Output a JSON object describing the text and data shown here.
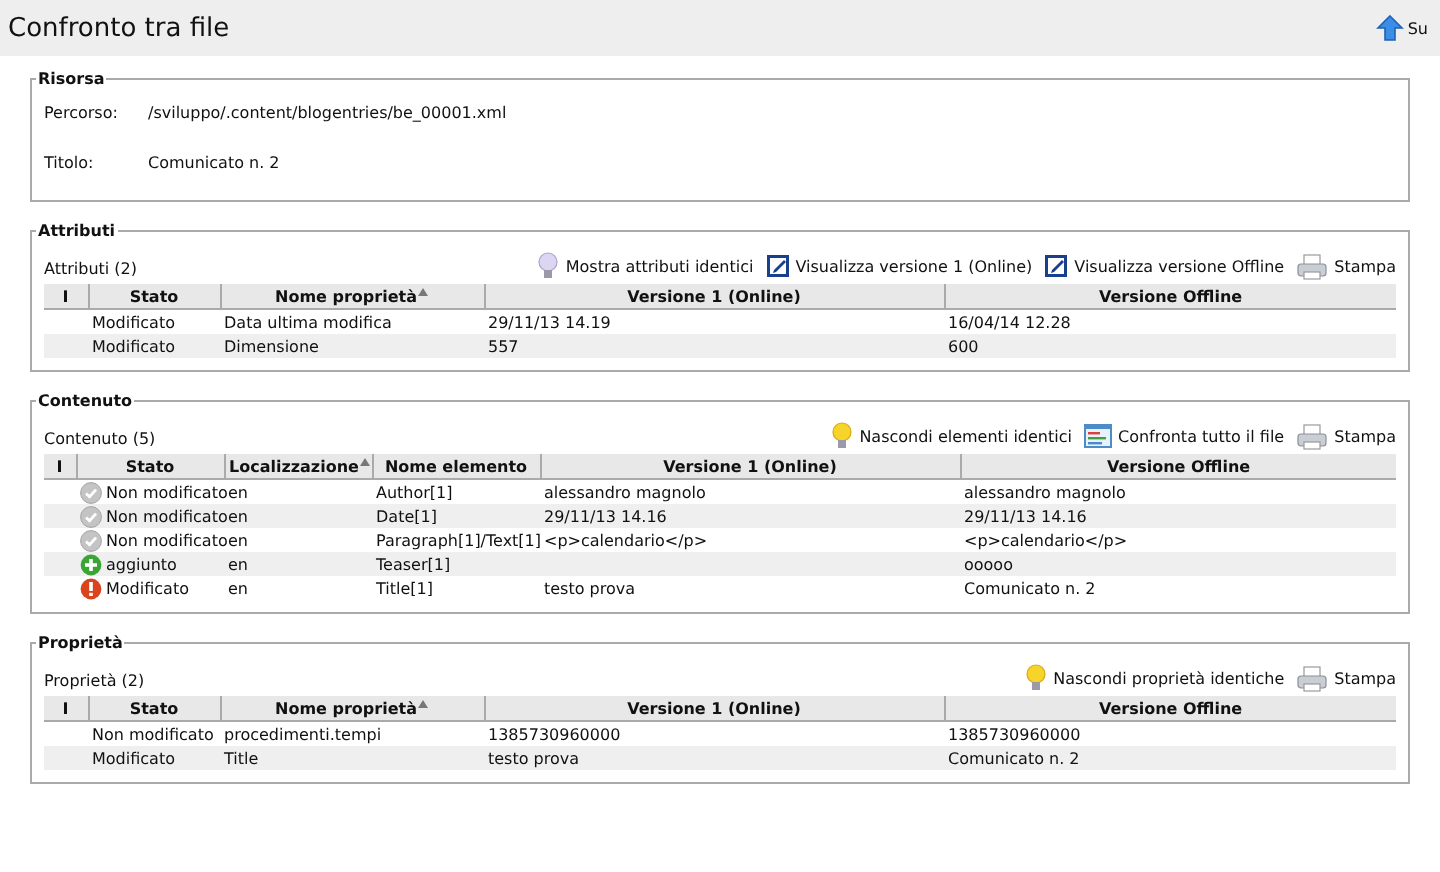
{
  "header": {
    "title": "Confronto tra file",
    "up_link": "Su"
  },
  "sections": [
    {
      "kind": "info",
      "legend": "Risorsa",
      "fields": [
        {
          "label": "Percorso:",
          "value": "/sviluppo/.content/blogentries/be_00001.xml"
        },
        {
          "label": "Titolo:",
          "value": "Comunicato n. 2"
        }
      ]
    },
    {
      "kind": "table",
      "legend": "Attributi",
      "count": "Attributi (2)",
      "actions": [
        {
          "kind": "bulb-off",
          "label": "Mostra attributi identici"
        },
        {
          "kind": "edit",
          "label": "Visualizza versione 1 (Online)"
        },
        {
          "kind": "edit",
          "label": "Visualizza versione Offline"
        },
        {
          "kind": "print",
          "label": "Stampa"
        }
      ],
      "columns": [
        {
          "label": "I",
          "sorted": false
        },
        {
          "label": "Stato",
          "sorted": false
        },
        {
          "label": "Nome proprietà",
          "sorted": true
        },
        {
          "label": "Versione 1 (Online)",
          "sorted": false
        },
        {
          "label": "Versione Offline",
          "sorted": false
        }
      ],
      "rows": [
        {
          "cells": [
            "",
            "Modificato",
            "Data ultima modifica",
            "29/11/13 14.19",
            "16/04/14 12.28"
          ]
        },
        {
          "cells": [
            "",
            "Modificato",
            "Dimensione",
            "557",
            "600"
          ]
        }
      ]
    },
    {
      "kind": "table",
      "legend": "Contenuto",
      "count": "Contenuto (5)",
      "actions": [
        {
          "kind": "bulb-on",
          "label": "Nascondi elementi identici"
        },
        {
          "kind": "compare",
          "label": "Confronta tutto il file"
        },
        {
          "kind": "print",
          "label": "Stampa"
        }
      ],
      "columns": [
        {
          "label": "I",
          "sorted": false
        },
        {
          "label": "Stato",
          "sorted": false
        },
        {
          "label": "Localizzazione",
          "sorted": true
        },
        {
          "label": "Nome elemento",
          "sorted": false
        },
        {
          "label": "Versione 1 (Online)",
          "sorted": false
        },
        {
          "label": "Versione Offline",
          "sorted": false
        }
      ],
      "rows": [
        {
          "kind": "unchanged",
          "cells": [
            "",
            "Non modificato",
            "en",
            "Author[1]",
            "alessandro magnolo",
            "alessandro magnolo"
          ]
        },
        {
          "kind": "unchanged",
          "cells": [
            "",
            "Non modificato",
            "en",
            "Date[1]",
            "29/11/13 14.16",
            "29/11/13 14.16"
          ]
        },
        {
          "kind": "unchanged",
          "cells": [
            "",
            "Non modificato",
            "en",
            "Paragraph[1]/Text[1]",
            "<p>calendario</p>",
            "<p>calendario</p>"
          ]
        },
        {
          "kind": "added",
          "cells": [
            "",
            "aggiunto",
            "en",
            "Teaser[1]",
            "",
            "ooooo"
          ]
        },
        {
          "kind": "modified",
          "cells": [
            "",
            "Modificato",
            "en",
            "Title[1]",
            "testo prova",
            "Comunicato n. 2"
          ]
        }
      ]
    },
    {
      "kind": "table",
      "legend": "Proprietà",
      "count": "Proprietà (2)",
      "actions": [
        {
          "kind": "bulb-on",
          "label": "Nascondi proprietà identiche"
        },
        {
          "kind": "print",
          "label": "Stampa"
        }
      ],
      "columns": [
        {
          "label": "I",
          "sorted": false
        },
        {
          "label": "Stato",
          "sorted": false
        },
        {
          "label": "Nome proprietà",
          "sorted": true
        },
        {
          "label": "Versione 1 (Online)",
          "sorted": false
        },
        {
          "label": "Versione Offline",
          "sorted": false
        }
      ],
      "rows": [
        {
          "cells": [
            "",
            "Non modificato",
            "procedimenti.tempi",
            "1385730960000",
            "1385730960000"
          ]
        },
        {
          "cells": [
            "",
            "Modificato",
            "Title",
            "testo prova",
            "Comunicato n. 2"
          ]
        }
      ]
    }
  ]
}
